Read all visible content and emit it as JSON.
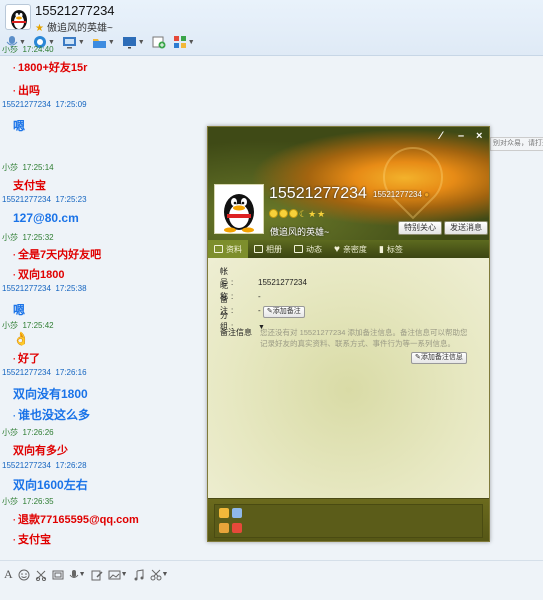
{
  "header": {
    "title": "15521277234",
    "signature": "傲追风的英雄~",
    "star_icon": "star-icon"
  },
  "toolbar": {
    "icons": [
      "microphone-icon",
      "video-icon",
      "screen-share-icon",
      "folder-icon",
      "remote-desktop-icon",
      "add-icon",
      "apps-icon"
    ]
  },
  "messages": [
    {
      "sender": "小莎",
      "time": "17:24:40",
      "text": "1800+好友15r",
      "side": "me"
    },
    {
      "sender": "",
      "time": "",
      "text": "出吗",
      "side": "me"
    },
    {
      "sender": "15521277234",
      "time": "17:25:09",
      "text": "嗯",
      "side": "other"
    },
    {
      "sender": "小莎",
      "time": "17:25:14",
      "text": "支付宝",
      "side": "me"
    },
    {
      "sender": "15521277234",
      "time": "17:25:23",
      "text": "127@80.cm",
      "side": "other"
    },
    {
      "sender": "小莎",
      "time": "17:25:32",
      "text": "全是7天内好友吧",
      "side": "me"
    },
    {
      "sender": "",
      "time": "",
      "text": "双向1800",
      "side": "me"
    },
    {
      "sender": "15521277234",
      "time": "17:25:38",
      "text": "嗯",
      "side": "other"
    },
    {
      "sender": "小莎",
      "time": "17:25:42",
      "text": "👌",
      "side": "me"
    },
    {
      "sender": "",
      "time": "",
      "text": "好了",
      "side": "me"
    },
    {
      "sender": "15521277234",
      "time": "17:26:16",
      "text": "双向没有1800",
      "side": "other"
    },
    {
      "sender": "",
      "time": "",
      "text": "谁也没这么多",
      "side": "other"
    },
    {
      "sender": "小莎",
      "time": "17:26:26",
      "text": "双向有多少",
      "side": "me"
    },
    {
      "sender": "15521277234",
      "time": "17:26:28",
      "text": "双向1600左右",
      "side": "other"
    },
    {
      "sender": "小莎",
      "time": "17:26:35",
      "text": "退款77165595@qq.com",
      "side": "me"
    },
    {
      "sender": "",
      "time": "",
      "text": "支付宝",
      "side": "me"
    }
  ],
  "input_tools": [
    "font-icon",
    "emoji-icon",
    "scissors-icon",
    "image-icon",
    "voice-icon",
    "edit-icon",
    "picture-icon",
    "music-icon",
    "cut-icon"
  ],
  "profile_card": {
    "name": "15521277234",
    "id": "15521277234",
    "signature": "傲追风的英雄~",
    "btn_special": "特别关心",
    "btn_send": "发送消息",
    "tabs": [
      "资料",
      "相册",
      "动态",
      "亲密度",
      "标签"
    ],
    "fields": [
      {
        "label": "帐　号:",
        "value": "15521277234"
      },
      {
        "label": "昵　称:",
        "value": "-"
      },
      {
        "label": "备　注:",
        "value": "-"
      },
      {
        "label": "分　组:",
        "value": ""
      }
    ],
    "add_remark_btn": "添加备注",
    "note_title": "备注信息",
    "note_text": "您还没有对 15521277234 添加备注信息。备注信息可以帮助您记录好友的真实资料、联系方式、事件行为等一系列信息。",
    "add_note_btn": "添加备注信息"
  },
  "peek_text": "别对众易，请打开"
}
